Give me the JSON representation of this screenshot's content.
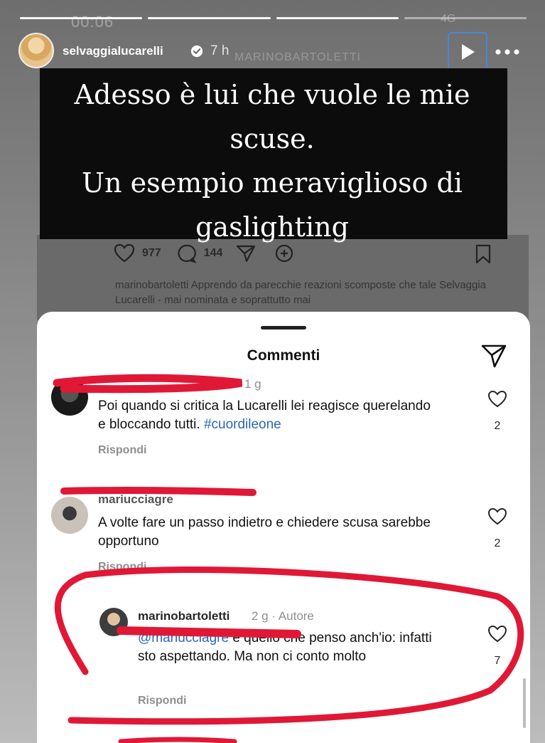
{
  "status_bar": {
    "time": "00:06",
    "network": "4G"
  },
  "story": {
    "username": "selvaggialucarelli",
    "posted_ago": "7 h",
    "ghost_account": "MARINOBARTOLETTI",
    "caption_lines": [
      "Adesso è lui che vuole le mie",
      "scuse.",
      "Un esempio meraviglioso di",
      "gaslighting"
    ],
    "progress": {
      "segments": 4,
      "completed": 3
    }
  },
  "background_post": {
    "likes": "977",
    "comments": "144",
    "text": "marinobartoletti Apprendo da parecchie reazioni scomposte che tale Selvaggia Lucarelli - mai nominata e soprattutto mai"
  },
  "comments_sheet": {
    "title": "Commenti",
    "comments": [
      {
        "meta": "1 g",
        "text": "Poi quando si critica la Lucarelli lei reagisce querelando e bloccando tutti.",
        "hashtag": "#cuordileone",
        "reply_label": "Rispondi",
        "likes": "2"
      },
      {
        "user_partial": "mariucciagre",
        "text": "A volte fare un passo indietro e chiedere scusa sarebbe opportuno",
        "reply_label": "Rispondi",
        "likes": "2"
      },
      {
        "user": "marinobartoletti",
        "meta": "2 g · Autore",
        "mention_partial": "@mariucciagre",
        "text": "è quello che penso anch'io: infatti sto aspettando. Ma non ci conto molto",
        "reply_label": "Rispondi",
        "likes": "7"
      }
    ]
  },
  "colors": {
    "scribble_red": "#e01836",
    "hashtag_blue": "#2a67b8",
    "highlight_border": "#4a86d8"
  }
}
